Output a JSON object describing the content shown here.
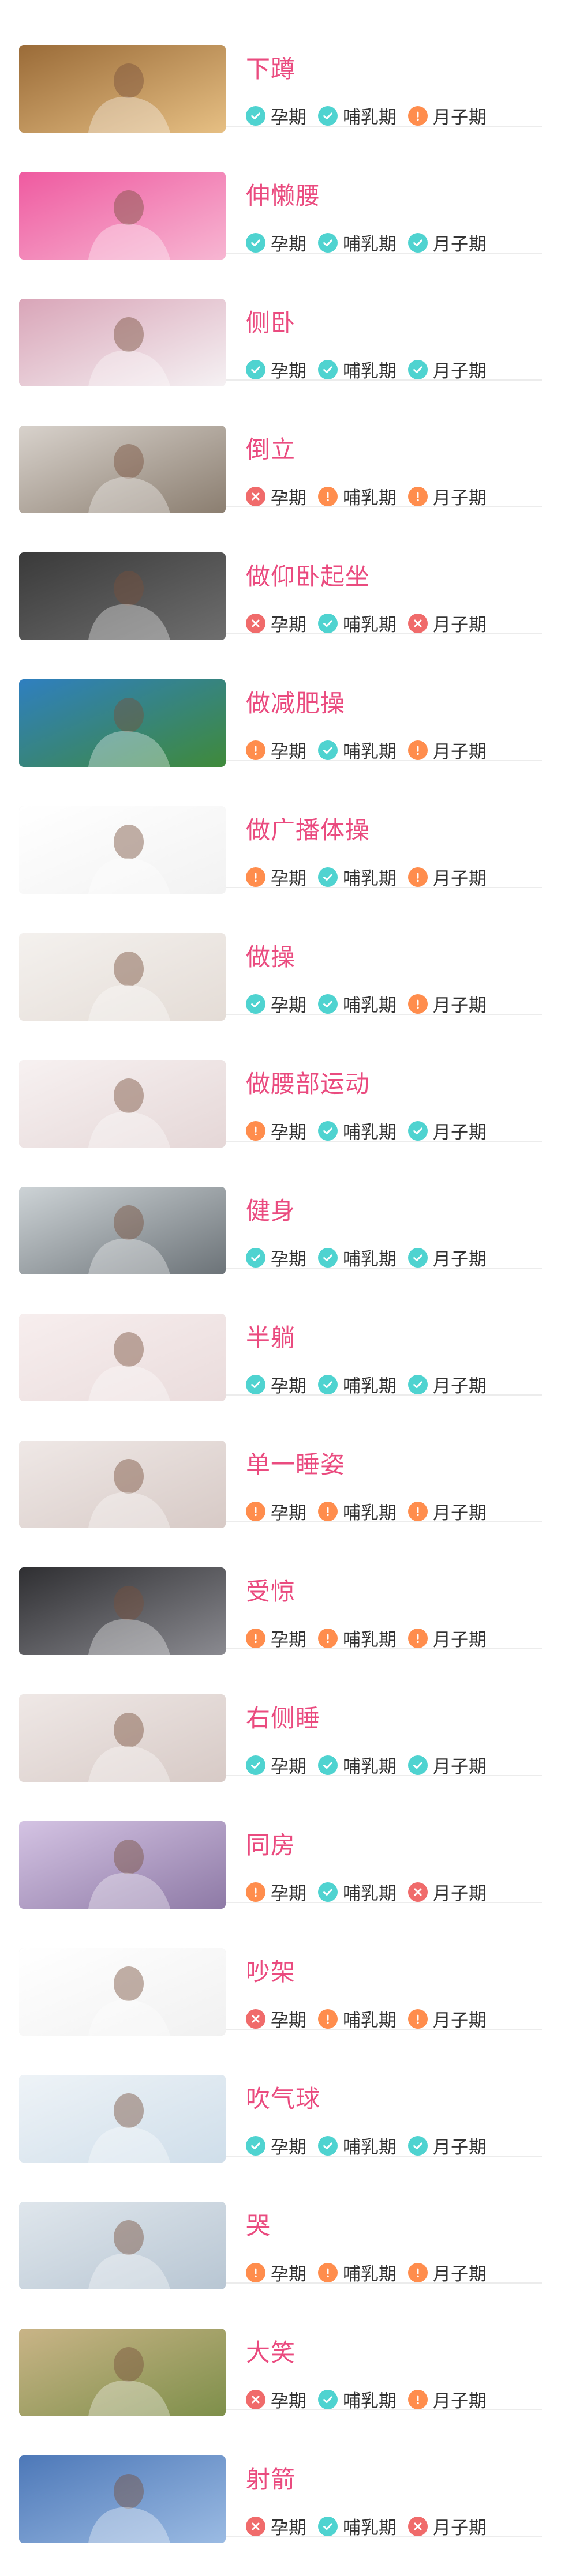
{
  "colors": {
    "title": "#ea4b7f",
    "ok": "#4fd3d0",
    "caution": "#ff8d4d",
    "forbidden": "#f06b6b",
    "divider": "#ececec"
  },
  "status_icons": {
    "ok": "check-icon",
    "caution": "exclamation-icon",
    "forbidden": "cross-icon"
  },
  "labels": {
    "pregnancy": "孕期",
    "lactation": "哺乳期",
    "confinement": "月子期"
  },
  "items": [
    {
      "title": "下蹲",
      "image": "woman-sitting-bed-photo",
      "statuses": [
        "ok",
        "ok",
        "caution"
      ],
      "theme": [
        "#9a6b38",
        "#e6bf83"
      ]
    },
    {
      "title": "伸懒腰",
      "image": "woman-stretching-photo",
      "statuses": [
        "ok",
        "ok",
        "ok"
      ],
      "theme": [
        "#ef5aa0",
        "#f7b6d2"
      ]
    },
    {
      "title": "侧卧",
      "image": "pregnant-woman-lying-side-photo",
      "statuses": [
        "ok",
        "ok",
        "ok"
      ],
      "theme": [
        "#d9a5b8",
        "#f5f1f3"
      ]
    },
    {
      "title": "倒立",
      "image": "headstand-silhouette-photo",
      "statuses": [
        "forbidden",
        "caution",
        "caution"
      ],
      "theme": [
        "#d8d2cc",
        "#8b7e70"
      ]
    },
    {
      "title": "做仰卧起坐",
      "image": "women-situps-gym-photo",
      "statuses": [
        "forbidden",
        "ok",
        "forbidden"
      ],
      "theme": [
        "#3a3a3a",
        "#6e6e6e"
      ]
    },
    {
      "title": "做减肥操",
      "image": "pregnant-woman-outdoors-photo",
      "statuses": [
        "caution",
        "ok",
        "caution"
      ],
      "theme": [
        "#2f7fc0",
        "#3f8a3a"
      ]
    },
    {
      "title": "做广播体操",
      "image": "yoga-pose-photo",
      "statuses": [
        "caution",
        "ok",
        "caution"
      ],
      "theme": [
        "#ffffff",
        "#f2f2f2"
      ]
    },
    {
      "title": "做操",
      "image": "pregnant-women-exercise-balls-photo",
      "statuses": [
        "ok",
        "ok",
        "caution"
      ],
      "theme": [
        "#f4f1ee",
        "#e4dcd6"
      ]
    },
    {
      "title": "做腰部运动",
      "image": "mother-baby-exercise-photo",
      "statuses": [
        "caution",
        "ok",
        "ok"
      ],
      "theme": [
        "#f7f1f1",
        "#e5d7d7"
      ]
    },
    {
      "title": "健身",
      "image": "woman-gym-bike-photo",
      "statuses": [
        "ok",
        "ok",
        "ok"
      ],
      "theme": [
        "#cdd3d6",
        "#6c7378"
      ]
    },
    {
      "title": "半躺",
      "image": "pregnant-woman-reclining-photo",
      "statuses": [
        "ok",
        "ok",
        "ok"
      ],
      "theme": [
        "#f7eeee",
        "#eadcdc"
      ]
    },
    {
      "title": "单一睡姿",
      "image": "woman-sleeping-pillow-photo",
      "statuses": [
        "caution",
        "caution",
        "caution"
      ],
      "theme": [
        "#efe8e6",
        "#d7cac6"
      ]
    },
    {
      "title": "受惊",
      "image": "woman-screaming-photo",
      "statuses": [
        "caution",
        "caution",
        "caution"
      ],
      "theme": [
        "#2f2f32",
        "#8a8a90"
      ]
    },
    {
      "title": "右侧睡",
      "image": "woman-sleeping-right-side-photo",
      "statuses": [
        "ok",
        "ok",
        "ok"
      ],
      "theme": [
        "#efe8e6",
        "#d7cac6"
      ]
    },
    {
      "title": "同房",
      "image": "couple-under-blanket-photo",
      "statuses": [
        "caution",
        "ok",
        "forbidden"
      ],
      "theme": [
        "#d4c3e3",
        "#8e7aa6"
      ]
    },
    {
      "title": "吵架",
      "image": "couple-arguing-photo",
      "statuses": [
        "forbidden",
        "caution",
        "caution"
      ],
      "theme": [
        "#ffffff",
        "#f1f1f1"
      ]
    },
    {
      "title": "吹气球",
      "image": "pregnant-woman-balloons-photo",
      "statuses": [
        "ok",
        "ok",
        "ok"
      ],
      "theme": [
        "#eef3f7",
        "#cfdeea"
      ]
    },
    {
      "title": "哭",
      "image": "woman-crying-photo",
      "statuses": [
        "caution",
        "caution",
        "caution"
      ],
      "theme": [
        "#dfe6ec",
        "#b8c6d3"
      ]
    },
    {
      "title": "大笑",
      "image": "woman-laughing-photo",
      "statuses": [
        "forbidden",
        "ok",
        "caution"
      ],
      "theme": [
        "#c9b487",
        "#7e8f4a"
      ]
    },
    {
      "title": "射箭",
      "image": "archer-sky-photo",
      "statuses": [
        "forbidden",
        "ok",
        "forbidden"
      ],
      "theme": [
        "#4d78b8",
        "#9bbbe3"
      ]
    }
  ]
}
